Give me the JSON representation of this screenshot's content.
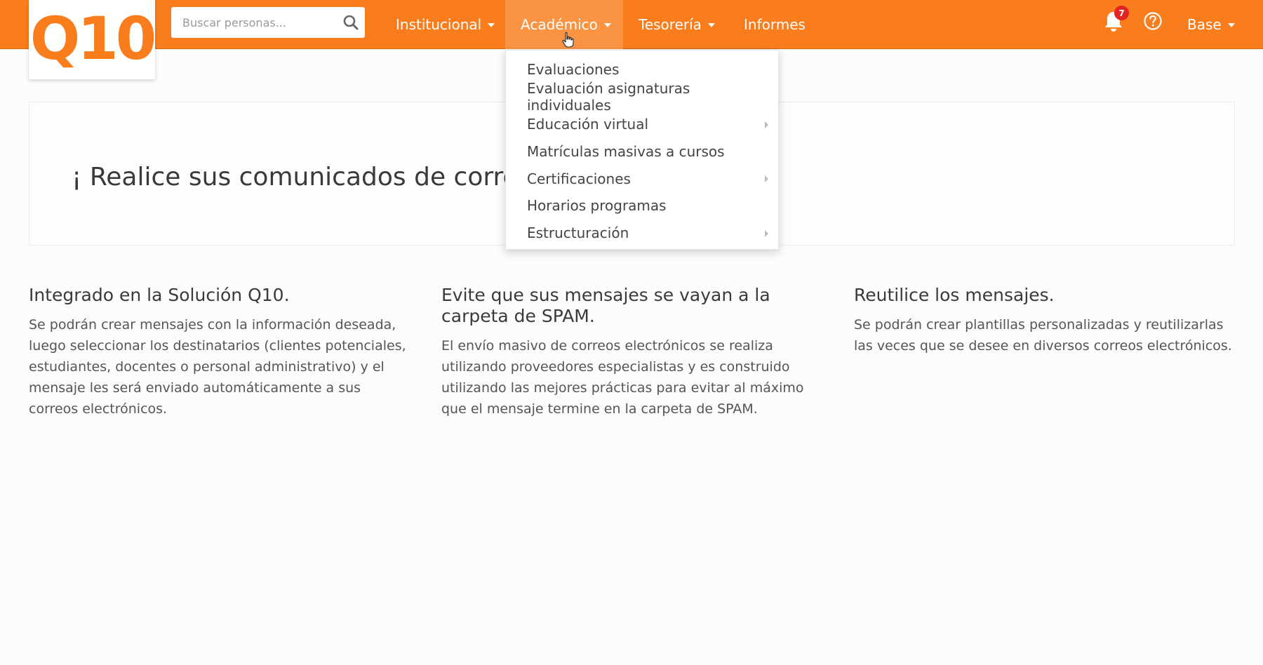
{
  "logo": {
    "text": "Q10"
  },
  "search": {
    "placeholder": "Buscar personas..."
  },
  "nav": {
    "institucional": "Institucional",
    "academico": "Académico",
    "tesoreria": "Tesorería",
    "informes": "Informes",
    "base": "Base"
  },
  "notifications": {
    "count": "7",
    "icon": "bell-icon"
  },
  "help": {
    "icon": "question-circle-icon"
  },
  "dropdown": {
    "items": [
      {
        "label": "Evaluaciones",
        "submenu": false
      },
      {
        "label": "Evaluación asignaturas individuales",
        "submenu": false
      },
      {
        "label": "Educación virtual",
        "submenu": true
      },
      {
        "label": "Matrículas masivas a cursos",
        "submenu": false
      },
      {
        "label": "Certificaciones",
        "submenu": true
      },
      {
        "label": "Horarios programas",
        "submenu": false
      },
      {
        "label": "Estructuración",
        "submenu": true
      }
    ]
  },
  "hero": {
    "title": "¡ Realice sus comunicados de correo ele"
  },
  "features": [
    {
      "title": "Integrado en la Solución Q10.",
      "text": "Se podrán crear mensajes con la información deseada, luego seleccionar los destinatarios (clientes potenciales, estudiantes, docentes o personal administrativo) y el mensaje les será enviado automáticamente a sus correos electrónicos."
    },
    {
      "title": "Evite que sus mensajes se vayan a la carpeta de SPAM.",
      "text": "El envío masivo de correos electrónicos se realiza utilizando proveedores especialistas y es construido utilizando las mejores prácticas para evitar al máximo que el mensaje termine en la carpeta de SPAM."
    },
    {
      "title": "Reutilice los mensajes.",
      "text": "Se podrán crear plantillas personalizadas y reutilizarlas las veces que se desee en diversos correos electrónicos."
    }
  ],
  "colors": {
    "brand": "#f97d1c",
    "active_nav": "#fa9443",
    "badge": "#e12525"
  }
}
